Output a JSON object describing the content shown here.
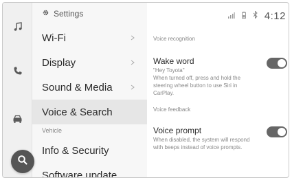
{
  "header": {
    "title": "Settings"
  },
  "status_bar": {
    "time": "4:12"
  },
  "rail": {
    "icons": [
      "music-icon",
      "phone-icon",
      "car-icon",
      "gear-icon"
    ]
  },
  "settings_list": {
    "items": [
      {
        "label": "Wi-Fi",
        "chevron": true
      },
      {
        "label": "Display",
        "chevron": true
      },
      {
        "label": "Sound & Media",
        "chevron": true
      },
      {
        "label": "Voice & Search",
        "chevron": false,
        "selected": true
      }
    ],
    "section_vehicle": "Vehicle",
    "items_vehicle": [
      {
        "label": "Info & Security"
      },
      {
        "label": "Software update"
      }
    ]
  },
  "detail": {
    "voice_recognition_label": "Voice recognition",
    "wake_word": {
      "title": "Wake word",
      "description_lines": [
        "\"Hey Toyota\"",
        "When turned off, press and hold the",
        "steering wheel button to use Siri in",
        "CarPlay."
      ],
      "enabled": true
    },
    "voice_feedback_label": "Voice feedback",
    "voice_prompt": {
      "title": "Voice prompt",
      "description_lines": [
        "When disabled, the system will respond",
        "with beeps instead of voice prompts."
      ],
      "enabled": true
    }
  },
  "colors": {
    "toggle_on": "#666666",
    "selected_row": "#e6e6e6",
    "rail": "#f0f0f0"
  }
}
